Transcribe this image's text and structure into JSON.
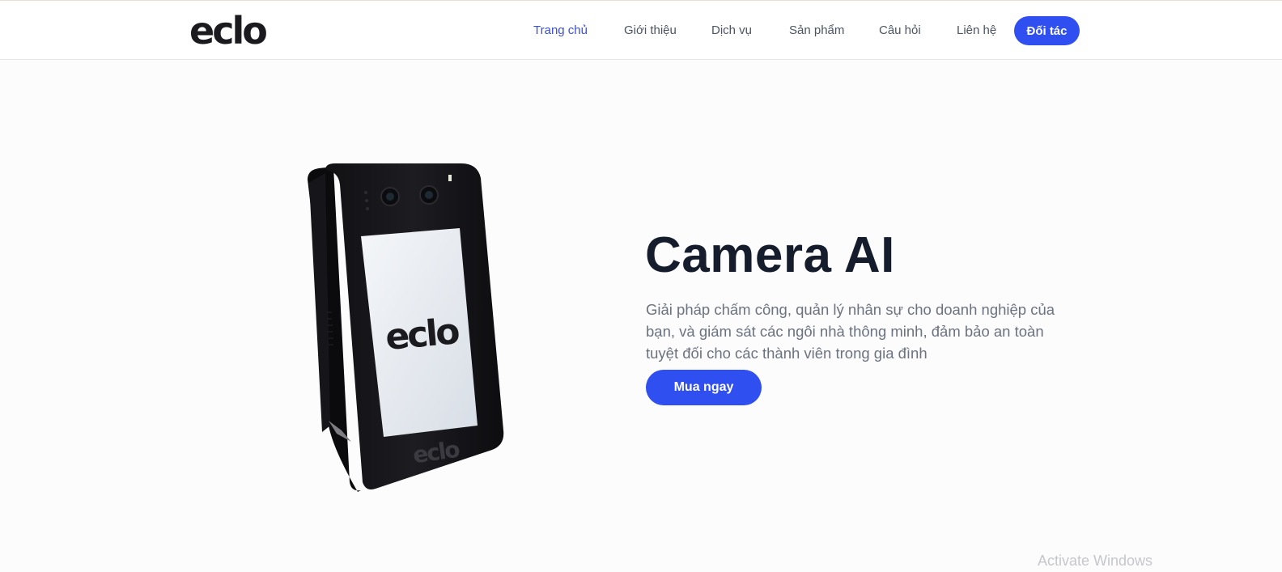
{
  "header": {
    "logo_text": "eclo",
    "nav": [
      {
        "label": "Trang chủ",
        "active": true
      },
      {
        "label": "Giới thiệu",
        "active": false
      },
      {
        "label": "Dịch vụ",
        "active": false
      },
      {
        "label": "Sản phẩm",
        "active": false
      },
      {
        "label": "Câu hỏi",
        "active": false
      },
      {
        "label": "Liên hệ",
        "active": false
      }
    ],
    "partner_button": "Đối tác"
  },
  "hero": {
    "title": "Camera AI",
    "description": "Giải pháp chấm công, quản lý nhân sự cho doanh nghiệp của bạn, và giám sát các ngôi nhà thông minh, đảm bảo an toàn tuyệt đối cho các thành viên trong gia đình",
    "buy_button": "Mua ngay",
    "device_screen_logo": "eclo",
    "device_bezel_logo": "eclo"
  },
  "overlay": {
    "watermark": "Activate Windows"
  },
  "colors": {
    "accent": "#2f4ff0",
    "active_nav": "#3b4fd8",
    "title": "#151c2c",
    "body_text": "#6b7280"
  }
}
